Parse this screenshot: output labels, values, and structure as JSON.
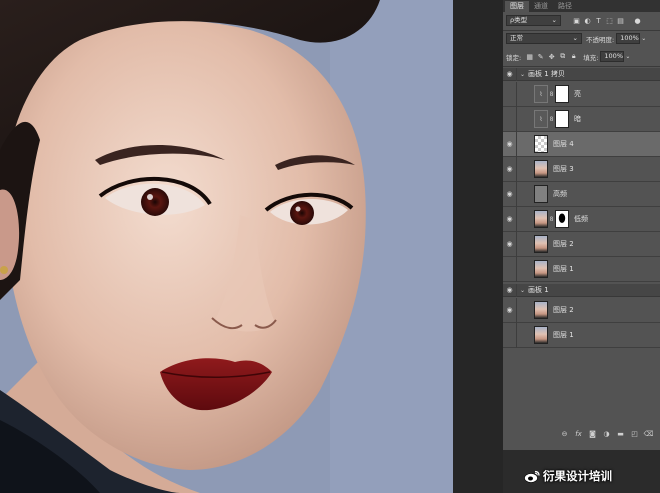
{
  "panel": {
    "tabs": [
      {
        "label": "图层",
        "active": true
      },
      {
        "label": "通道",
        "active": false
      },
      {
        "label": "路径",
        "active": false
      }
    ],
    "filter": {
      "label": "ρ类型"
    },
    "blend_mode": "正常",
    "opacity": {
      "label": "不透明度:",
      "value": "100%"
    },
    "lock": {
      "label": "锁定:"
    },
    "fill": {
      "label": "填充:",
      "value": "100%"
    },
    "groups": [
      {
        "name": "画板 1 拷贝",
        "expanded": true
      },
      {
        "name": "画板 1",
        "expanded": true
      }
    ],
    "layers_group1": [
      {
        "name": "亮",
        "visible": false,
        "type": "adjustment"
      },
      {
        "name": "暗",
        "visible": false,
        "type": "adjustment"
      },
      {
        "name": "图层 4",
        "visible": true,
        "type": "transparent",
        "selected": true
      },
      {
        "name": "图层 3",
        "visible": true,
        "type": "photo"
      },
      {
        "name": "高频",
        "visible": true,
        "type": "gray"
      },
      {
        "name": "低频",
        "visible": true,
        "type": "photo-mask"
      },
      {
        "name": "图层 2",
        "visible": true,
        "type": "photo"
      },
      {
        "name": "图层 1",
        "visible": false,
        "type": "photo"
      }
    ],
    "layers_group2": [
      {
        "name": "图层 2",
        "visible": true,
        "type": "photo"
      },
      {
        "name": "图层 1",
        "visible": false,
        "type": "photo"
      }
    ],
    "footer_icons": [
      "link-icon",
      "fx-icon",
      "mask-icon",
      "adjustment-icon",
      "folder-icon",
      "new-layer-icon",
      "trash-icon"
    ],
    "footer_fx": "fx"
  },
  "watermark": {
    "text": "衍果设计培训",
    "icon": "weibo-icon"
  },
  "colors": {
    "background": "#8e9ab5",
    "panel": "#535353",
    "panel_dark": "#323232",
    "selected_layer": "#6a6a6a",
    "lips": "#7a0f13"
  }
}
